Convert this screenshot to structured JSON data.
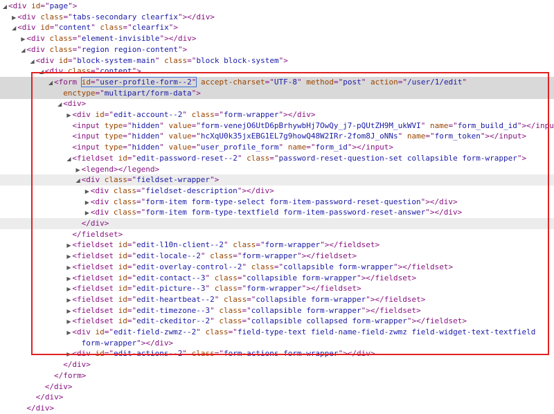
{
  "rows": [
    {
      "indent": 0,
      "twisty": "open",
      "parts": [
        [
          "tag",
          "<div "
        ],
        [
          "an",
          "id"
        ],
        [
          "tag",
          "=\""
        ],
        [
          "av",
          "page"
        ],
        [
          "tag",
          "\">"
        ]
      ]
    },
    {
      "indent": 1,
      "twisty": "closed",
      "parts": [
        [
          "tag",
          "<div "
        ],
        [
          "an",
          "class"
        ],
        [
          "tag",
          "=\""
        ],
        [
          "av",
          "tabs-secondary clearfix"
        ],
        [
          "tag",
          "\"></div>"
        ]
      ]
    },
    {
      "indent": 1,
      "twisty": "open",
      "parts": [
        [
          "tag",
          "<div "
        ],
        [
          "an",
          "id"
        ],
        [
          "tag",
          "=\""
        ],
        [
          "av",
          "content"
        ],
        [
          "tag",
          "\" "
        ],
        [
          "an",
          "class"
        ],
        [
          "tag",
          "=\""
        ],
        [
          "av",
          "clearfix"
        ],
        [
          "tag",
          "\">"
        ]
      ]
    },
    {
      "indent": 2,
      "twisty": "closed",
      "parts": [
        [
          "tag",
          "<div "
        ],
        [
          "an",
          "class"
        ],
        [
          "tag",
          "=\""
        ],
        [
          "av",
          "element-invisible"
        ],
        [
          "tag",
          "\"></div>"
        ]
      ]
    },
    {
      "indent": 2,
      "twisty": "open",
      "parts": [
        [
          "tag",
          "<div "
        ],
        [
          "an",
          "class"
        ],
        [
          "tag",
          "=\""
        ],
        [
          "av",
          "region region-content"
        ],
        [
          "tag",
          "\">"
        ]
      ]
    },
    {
      "indent": 3,
      "twisty": "open",
      "parts": [
        [
          "tag",
          "<div "
        ],
        [
          "an",
          "id"
        ],
        [
          "tag",
          "=\""
        ],
        [
          "av",
          "block-system-main"
        ],
        [
          "tag",
          "\" "
        ],
        [
          "an",
          "class"
        ],
        [
          "tag",
          "=\""
        ],
        [
          "av",
          "block block-system"
        ],
        [
          "tag",
          "\">"
        ]
      ]
    },
    {
      "indent": 4,
      "twisty": "open",
      "parts": [
        [
          "tag",
          "<div "
        ],
        [
          "an",
          "class"
        ],
        [
          "tag",
          "=\""
        ],
        [
          "av",
          "content"
        ],
        [
          "tag",
          "\">"
        ]
      ]
    },
    {
      "indent": 5,
      "twisty": "open",
      "selected": true,
      "parts": [
        [
          "tag",
          "<form "
        ],
        [
          "anhl",
          "id"
        ],
        [
          "taghl",
          "=\""
        ],
        [
          "avhl",
          "user-profile-form--2"
        ],
        [
          "taghl",
          "\""
        ],
        [
          "tag",
          " "
        ],
        [
          "an",
          "accept-charset"
        ],
        [
          "tag",
          "=\""
        ],
        [
          "av",
          "UTF-8"
        ],
        [
          "tag",
          "\" "
        ],
        [
          "an",
          "method"
        ],
        [
          "tag",
          "=\""
        ],
        [
          "av",
          "post"
        ],
        [
          "tag",
          "\" "
        ],
        [
          "an",
          "action"
        ],
        [
          "tag",
          "=\""
        ],
        [
          "av",
          "/user/1/edit"
        ],
        [
          "tag",
          "\""
        ]
      ]
    },
    {
      "indent": 6,
      "twisty": "none",
      "selected": true,
      "parts": [
        [
          "an",
          "enctype"
        ],
        [
          "tag",
          "=\""
        ],
        [
          "av",
          "multipart/form-data"
        ],
        [
          "tag",
          "\">"
        ]
      ]
    },
    {
      "indent": 6,
      "twisty": "open",
      "parts": [
        [
          "tag",
          "<div>"
        ]
      ]
    },
    {
      "indent": 7,
      "twisty": "closed",
      "parts": [
        [
          "tag",
          "<div "
        ],
        [
          "an",
          "id"
        ],
        [
          "tag",
          "=\""
        ],
        [
          "av",
          "edit-account--2"
        ],
        [
          "tag",
          "\" "
        ],
        [
          "an",
          "class"
        ],
        [
          "tag",
          "=\""
        ],
        [
          "av",
          "form-wrapper"
        ],
        [
          "tag",
          "\"></div>"
        ]
      ]
    },
    {
      "indent": 7,
      "twisty": "none",
      "parts": [
        [
          "tag",
          "<input "
        ],
        [
          "an",
          "type"
        ],
        [
          "tag",
          "=\""
        ],
        [
          "av",
          "hidden"
        ],
        [
          "tag",
          "\" "
        ],
        [
          "an",
          "value"
        ],
        [
          "tag",
          "=\""
        ],
        [
          "av",
          "form-venejO6UtD6pBrhywbHj7OwQy_j7-pQUtZH9M_ukWVI"
        ],
        [
          "tag",
          "\" "
        ],
        [
          "an",
          "name"
        ],
        [
          "tag",
          "=\""
        ],
        [
          "av",
          "form_build_id"
        ],
        [
          "tag",
          "\"></input>"
        ]
      ]
    },
    {
      "indent": 7,
      "twisty": "none",
      "parts": [
        [
          "tag",
          "<input "
        ],
        [
          "an",
          "type"
        ],
        [
          "tag",
          "=\""
        ],
        [
          "av",
          "hidden"
        ],
        [
          "tag",
          "\" "
        ],
        [
          "an",
          "value"
        ],
        [
          "tag",
          "=\""
        ],
        [
          "av",
          "hcXqU0k35jxEBG1EL7g9howQ48W2IRr-2fom8J_oNNs"
        ],
        [
          "tag",
          "\" "
        ],
        [
          "an",
          "name"
        ],
        [
          "tag",
          "=\""
        ],
        [
          "av",
          "form_token"
        ],
        [
          "tag",
          "\"></input>"
        ]
      ]
    },
    {
      "indent": 7,
      "twisty": "none",
      "parts": [
        [
          "tag",
          "<input "
        ],
        [
          "an",
          "type"
        ],
        [
          "tag",
          "=\""
        ],
        [
          "av",
          "hidden"
        ],
        [
          "tag",
          "\" "
        ],
        [
          "an",
          "value"
        ],
        [
          "tag",
          "=\""
        ],
        [
          "av",
          "user_profile_form"
        ],
        [
          "tag",
          "\" "
        ],
        [
          "an",
          "name"
        ],
        [
          "tag",
          "=\""
        ],
        [
          "av",
          "form_id"
        ],
        [
          "tag",
          "\"></input>"
        ]
      ]
    },
    {
      "indent": 7,
      "twisty": "open",
      "parts": [
        [
          "tag",
          "<fieldset "
        ],
        [
          "an",
          "id"
        ],
        [
          "tag",
          "=\""
        ],
        [
          "av",
          "edit-password-reset--2"
        ],
        [
          "tag",
          "\" "
        ],
        [
          "an",
          "class"
        ],
        [
          "tag",
          "=\""
        ],
        [
          "av",
          "password-reset-question-set collapsible form-wrapper"
        ],
        [
          "tag",
          "\">"
        ]
      ]
    },
    {
      "indent": 8,
      "twisty": "closed",
      "parts": [
        [
          "tag",
          "<legend></legend>"
        ]
      ]
    },
    {
      "indent": 8,
      "twisty": "open",
      "hover": true,
      "parts": [
        [
          "tag",
          "<div "
        ],
        [
          "an",
          "class"
        ],
        [
          "tag",
          "=\""
        ],
        [
          "av",
          "fieldset-wrapper"
        ],
        [
          "tag",
          "\">"
        ]
      ]
    },
    {
      "indent": 9,
      "twisty": "closed",
      "parts": [
        [
          "tag",
          "<div "
        ],
        [
          "an",
          "class"
        ],
        [
          "tag",
          "=\""
        ],
        [
          "av",
          "fieldset-description"
        ],
        [
          "tag",
          "\"></div>"
        ]
      ]
    },
    {
      "indent": 9,
      "twisty": "closed",
      "parts": [
        [
          "tag",
          "<div "
        ],
        [
          "an",
          "class"
        ],
        [
          "tag",
          "=\""
        ],
        [
          "av",
          "form-item form-type-select form-item-password-reset-question"
        ],
        [
          "tag",
          "\"></div>"
        ]
      ]
    },
    {
      "indent": 9,
      "twisty": "closed",
      "parts": [
        [
          "tag",
          "<div "
        ],
        [
          "an",
          "class"
        ],
        [
          "tag",
          "=\""
        ],
        [
          "av",
          "form-item form-type-textfield form-item-password-reset-answer"
        ],
        [
          "tag",
          "\"></div>"
        ]
      ]
    },
    {
      "indent": 8,
      "twisty": "none",
      "hover": true,
      "parts": [
        [
          "tag",
          "</div>"
        ]
      ]
    },
    {
      "indent": 7,
      "twisty": "none",
      "parts": [
        [
          "tag",
          "</fieldset>"
        ]
      ]
    },
    {
      "indent": 7,
      "twisty": "closed",
      "parts": [
        [
          "tag",
          "<fieldset "
        ],
        [
          "an",
          "id"
        ],
        [
          "tag",
          "=\""
        ],
        [
          "av",
          "edit-l10n-client--2"
        ],
        [
          "tag",
          "\" "
        ],
        [
          "an",
          "class"
        ],
        [
          "tag",
          "=\""
        ],
        [
          "av",
          "form-wrapper"
        ],
        [
          "tag",
          "\"></fieldset>"
        ]
      ]
    },
    {
      "indent": 7,
      "twisty": "closed",
      "parts": [
        [
          "tag",
          "<fieldset "
        ],
        [
          "an",
          "id"
        ],
        [
          "tag",
          "=\""
        ],
        [
          "av",
          "edit-locale--2"
        ],
        [
          "tag",
          "\" "
        ],
        [
          "an",
          "class"
        ],
        [
          "tag",
          "=\""
        ],
        [
          "av",
          "form-wrapper"
        ],
        [
          "tag",
          "\"></fieldset>"
        ]
      ]
    },
    {
      "indent": 7,
      "twisty": "closed",
      "parts": [
        [
          "tag",
          "<fieldset "
        ],
        [
          "an",
          "id"
        ],
        [
          "tag",
          "=\""
        ],
        [
          "av",
          "edit-overlay-control--2"
        ],
        [
          "tag",
          "\" "
        ],
        [
          "an",
          "class"
        ],
        [
          "tag",
          "=\""
        ],
        [
          "av",
          "collapsible form-wrapper"
        ],
        [
          "tag",
          "\"></fieldset>"
        ]
      ]
    },
    {
      "indent": 7,
      "twisty": "closed",
      "parts": [
        [
          "tag",
          "<fieldset "
        ],
        [
          "an",
          "id"
        ],
        [
          "tag",
          "=\""
        ],
        [
          "av",
          "edit-contact--3"
        ],
        [
          "tag",
          "\" "
        ],
        [
          "an",
          "class"
        ],
        [
          "tag",
          "=\""
        ],
        [
          "av",
          "collapsible form-wrapper"
        ],
        [
          "tag",
          "\"></fieldset>"
        ]
      ]
    },
    {
      "indent": 7,
      "twisty": "closed",
      "parts": [
        [
          "tag",
          "<fieldset "
        ],
        [
          "an",
          "id"
        ],
        [
          "tag",
          "=\""
        ],
        [
          "av",
          "edit-picture--3"
        ],
        [
          "tag",
          "\" "
        ],
        [
          "an",
          "class"
        ],
        [
          "tag",
          "=\""
        ],
        [
          "av",
          "form-wrapper"
        ],
        [
          "tag",
          "\"></fieldset>"
        ]
      ]
    },
    {
      "indent": 7,
      "twisty": "closed",
      "parts": [
        [
          "tag",
          "<fieldset "
        ],
        [
          "an",
          "id"
        ],
        [
          "tag",
          "=\""
        ],
        [
          "av",
          "edit-heartbeat--2"
        ],
        [
          "tag",
          "\" "
        ],
        [
          "an",
          "class"
        ],
        [
          "tag",
          "=\""
        ],
        [
          "av",
          "collapsible form-wrapper"
        ],
        [
          "tag",
          "\"></fieldset>"
        ]
      ]
    },
    {
      "indent": 7,
      "twisty": "closed",
      "parts": [
        [
          "tag",
          "<fieldset "
        ],
        [
          "an",
          "id"
        ],
        [
          "tag",
          "=\""
        ],
        [
          "av",
          "edit-timezone--3"
        ],
        [
          "tag",
          "\" "
        ],
        [
          "an",
          "class"
        ],
        [
          "tag",
          "=\""
        ],
        [
          "av",
          "collapsible form-wrapper"
        ],
        [
          "tag",
          "\"></fieldset>"
        ]
      ]
    },
    {
      "indent": 7,
      "twisty": "closed",
      "parts": [
        [
          "tag",
          "<fieldset "
        ],
        [
          "an",
          "id"
        ],
        [
          "tag",
          "=\""
        ],
        [
          "av",
          "edit-ckeditor--2"
        ],
        [
          "tag",
          "\" "
        ],
        [
          "an",
          "class"
        ],
        [
          "tag",
          "=\""
        ],
        [
          "av",
          "collapsible collapsed form-wrapper"
        ],
        [
          "tag",
          "\"></fieldset>"
        ]
      ]
    },
    {
      "indent": 7,
      "twisty": "closed",
      "parts": [
        [
          "tag",
          "<div "
        ],
        [
          "an",
          "id"
        ],
        [
          "tag",
          "=\""
        ],
        [
          "av",
          "edit-field-zwmz--2"
        ],
        [
          "tag",
          "\" "
        ],
        [
          "an",
          "class"
        ],
        [
          "tag",
          "=\""
        ],
        [
          "av",
          "field-type-text field-name-field-zwmz field-widget-text-textfield"
        ]
      ]
    },
    {
      "indent": 8,
      "twisty": "none",
      "parts": [
        [
          "av",
          "form-wrapper"
        ],
        [
          "tag",
          "\"></div>"
        ]
      ]
    },
    {
      "indent": 7,
      "twisty": "closed",
      "parts": [
        [
          "tag",
          "<div "
        ],
        [
          "an",
          "id"
        ],
        [
          "tag",
          "=\""
        ],
        [
          "av",
          "edit-actions--2"
        ],
        [
          "tag",
          "\" "
        ],
        [
          "an",
          "class"
        ],
        [
          "tag",
          "=\""
        ],
        [
          "av",
          "form-actions form-wrapper"
        ],
        [
          "tag",
          "\"></div>"
        ]
      ]
    },
    {
      "indent": 6,
      "twisty": "none",
      "parts": [
        [
          "tag",
          "</div>"
        ]
      ]
    },
    {
      "indent": 5,
      "twisty": "none",
      "parts": [
        [
          "tag",
          "</form>"
        ]
      ]
    },
    {
      "indent": 4,
      "twisty": "none",
      "parts": [
        [
          "tag",
          "</div>"
        ]
      ]
    },
    {
      "indent": 3,
      "twisty": "none",
      "parts": [
        [
          "tag",
          "</div>"
        ]
      ]
    },
    {
      "indent": 2,
      "twisty": "none",
      "parts": [
        [
          "tag",
          "</div>"
        ]
      ]
    }
  ],
  "colors": {
    "tag": "#881280",
    "attr_name": "#994500",
    "attr_value": "#1a1aa6",
    "selection": "#d9d9d9",
    "highlight_border": "#e02020"
  }
}
